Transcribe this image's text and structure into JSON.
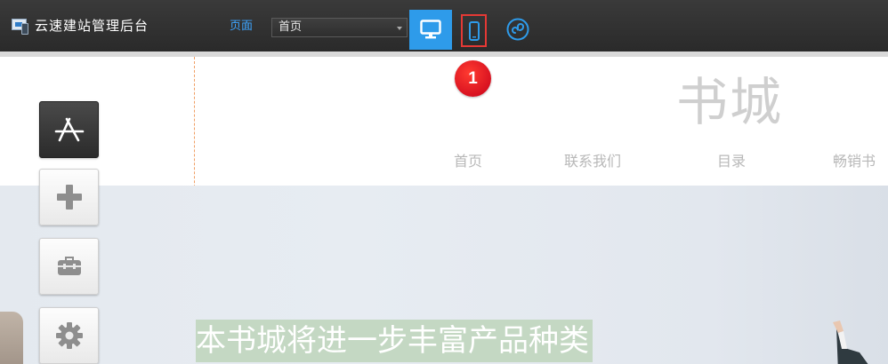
{
  "topbar": {
    "app_title": "云速建站管理后台",
    "page_label": "页面",
    "page_select_value": "首页",
    "buttons": [
      {
        "name": "desktop-view",
        "icon": "monitor-icon",
        "active": true
      },
      {
        "name": "mobile-view",
        "icon": "phone-icon",
        "highlighted": true
      },
      {
        "name": "mini-program-view",
        "icon": "mini-program-icon"
      }
    ],
    "accent_color": "#2e9bea",
    "highlight_color": "#e53935"
  },
  "step_badge": "1",
  "tools": [
    {
      "name": "design-tool",
      "icon": "app-store-icon",
      "active": true
    },
    {
      "name": "add-tool",
      "icon": "plus-icon"
    },
    {
      "name": "toolbox-tool",
      "icon": "toolbox-icon"
    },
    {
      "name": "settings-tool",
      "icon": "gear-icon"
    }
  ],
  "site": {
    "title": "书城",
    "nav": [
      "首页",
      "联系我们",
      "目录",
      "畅销书"
    ],
    "banner_text": "本书城将进一步丰富产品种类"
  }
}
